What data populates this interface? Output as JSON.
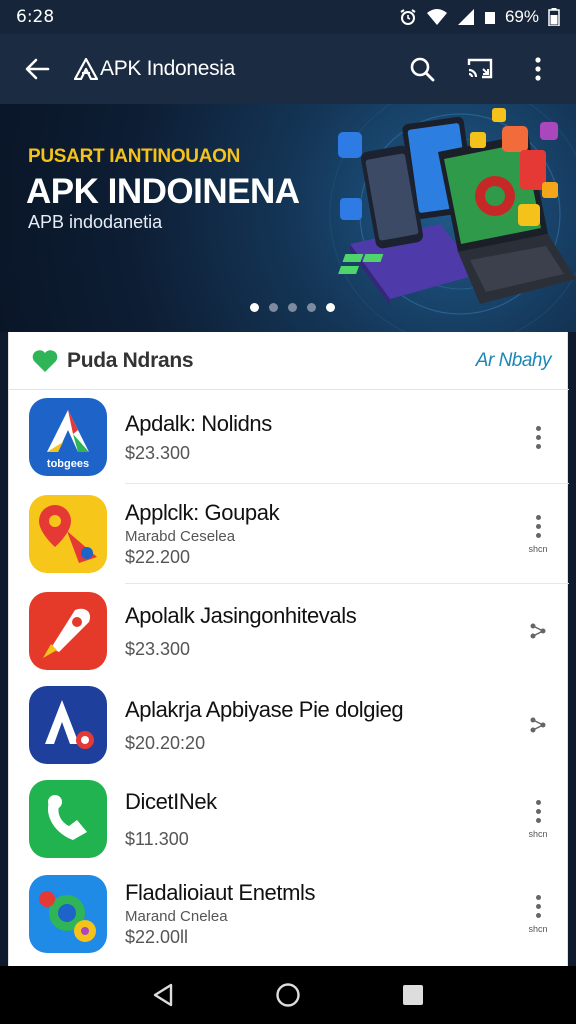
{
  "status_bar": {
    "time": "6:28",
    "battery": "69%"
  },
  "app_bar": {
    "title": "APK Indonesia"
  },
  "banner": {
    "eyebrow": "PUSART IANTINOUAON",
    "headline": "APK INDOINENA",
    "subline": "APB indodanetia",
    "slides": 5,
    "active_slide": 0
  },
  "section": {
    "title": "Puda Ndrans",
    "more_label": "Ar Nbahy"
  },
  "apps": [
    {
      "name": "Apdalk: Nolidns",
      "developer": "",
      "price": "$23.300",
      "icon_label": "tobgees"
    },
    {
      "name": "Applclk: Goupak",
      "developer": "Marabd Ceselea",
      "price": "$22.200",
      "menu_note": "shcn"
    },
    {
      "name": "Apolalk Jasingonhitevals",
      "developer": "",
      "price": "$23.300"
    },
    {
      "name": "Aplakrja Apbiyase Pie dolgieg",
      "developer": "",
      "price": "$20.20:20"
    },
    {
      "name": "DicetINek",
      "developer": "",
      "price": "$11.300",
      "menu_note": "shcn"
    },
    {
      "name": "Fladalioiaut Enetmls",
      "developer": "Marand Cnelea",
      "price": "$22.00ll",
      "menu_note": "shcn"
    }
  ],
  "colors": {
    "accent": "#1a87b5",
    "banner_eyebrow": "#f4c21b",
    "app_bar": "#1b2b42"
  }
}
